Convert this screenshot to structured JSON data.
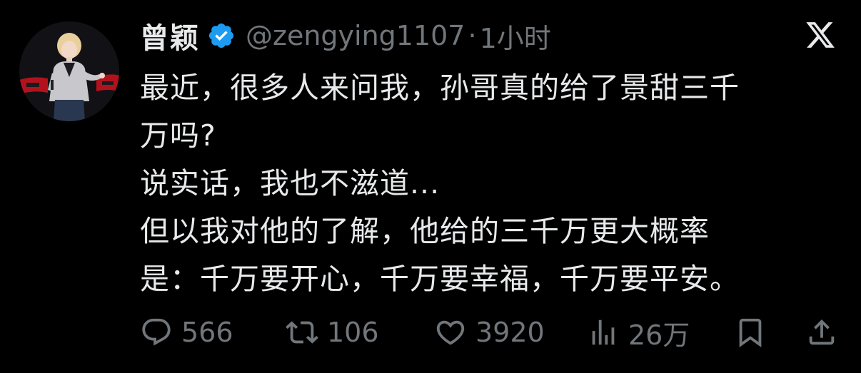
{
  "author": {
    "display_name": "曾颖",
    "handle": "@zengying1107",
    "separator": "·",
    "time": "1小时",
    "verified": true,
    "verified_color": "#1d9bf0"
  },
  "tweet": {
    "lines": [
      "最近，很多人来问我，孙哥真的给了景甜三千",
      "万吗?",
      "说实话，我也不滋道...",
      "但以我对他的了解，他给的三千万更大概率",
      "是：千万要开心，千万要幸福，千万要平安。"
    ]
  },
  "actions": {
    "reply": {
      "icon": "reply-icon",
      "count": "566"
    },
    "repost": {
      "icon": "repost-icon",
      "count": "106"
    },
    "like": {
      "icon": "heart-icon",
      "count": "3920"
    },
    "views": {
      "icon": "views-icon",
      "count": "26万"
    },
    "bookmark": {
      "icon": "bookmark-icon"
    },
    "share": {
      "icon": "share-icon"
    }
  },
  "platform": {
    "logo": "x-logo-icon"
  },
  "colors": {
    "background": "#000000",
    "text": "#e7e9ea",
    "secondary": "#71767b"
  }
}
